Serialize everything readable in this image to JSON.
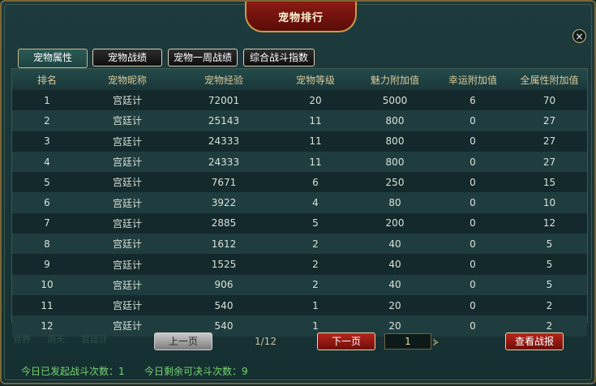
{
  "window": {
    "title": "宠物排行",
    "close_glyph": "×"
  },
  "tabs": [
    {
      "label": "宠物属性"
    },
    {
      "label": "宠物战绩"
    },
    {
      "label": "宠物一周战绩"
    },
    {
      "label": "综合战斗指数"
    }
  ],
  "table": {
    "headers": [
      "排名",
      "宠物昵称",
      "宠物经验",
      "宠物等级",
      "魅力附加值",
      "幸运附加值",
      "全属性附加值"
    ],
    "rows": [
      [
        "1",
        "宫廷计",
        "72001",
        "20",
        "5000",
        "6",
        "70"
      ],
      [
        "2",
        "宫廷计",
        "25143",
        "11",
        "800",
        "0",
        "27"
      ],
      [
        "3",
        "宫廷计",
        "24333",
        "11",
        "800",
        "0",
        "27"
      ],
      [
        "4",
        "宫廷计",
        "24333",
        "11",
        "800",
        "0",
        "27"
      ],
      [
        "5",
        "宫廷计",
        "7671",
        "6",
        "250",
        "0",
        "15"
      ],
      [
        "6",
        "宫廷计",
        "3922",
        "4",
        "80",
        "0",
        "10"
      ],
      [
        "7",
        "宫廷计",
        "2885",
        "5",
        "200",
        "0",
        "12"
      ],
      [
        "8",
        "宫廷计",
        "1612",
        "2",
        "40",
        "0",
        "5"
      ],
      [
        "9",
        "宫廷计",
        "1525",
        "2",
        "40",
        "0",
        "5"
      ],
      [
        "10",
        "宫廷计",
        "906",
        "2",
        "40",
        "0",
        "5"
      ],
      [
        "11",
        "宫廷计",
        "540",
        "1",
        "20",
        "0",
        "2"
      ],
      [
        "12",
        "宫廷计",
        "540",
        "1",
        "20",
        "0",
        "2"
      ]
    ]
  },
  "pagination": {
    "prev_label": "上一页",
    "next_label": "下一页",
    "page_indicator": "1/12",
    "page_input_value": "1",
    "jump_icon": "jump-icon"
  },
  "actions": {
    "view_report_label": "查看战报"
  },
  "status": {
    "initiated_today": "今日已发起战斗次数：1",
    "remaining_today": "今日剩余可决斗次数：9"
  },
  "background_text": [
    "世界",
    "洞天",
    "宫廷计"
  ],
  "colors": {
    "accent_gold": "#c89c4a",
    "title_red": "#8b1b13",
    "status_green": "#76d66e"
  }
}
